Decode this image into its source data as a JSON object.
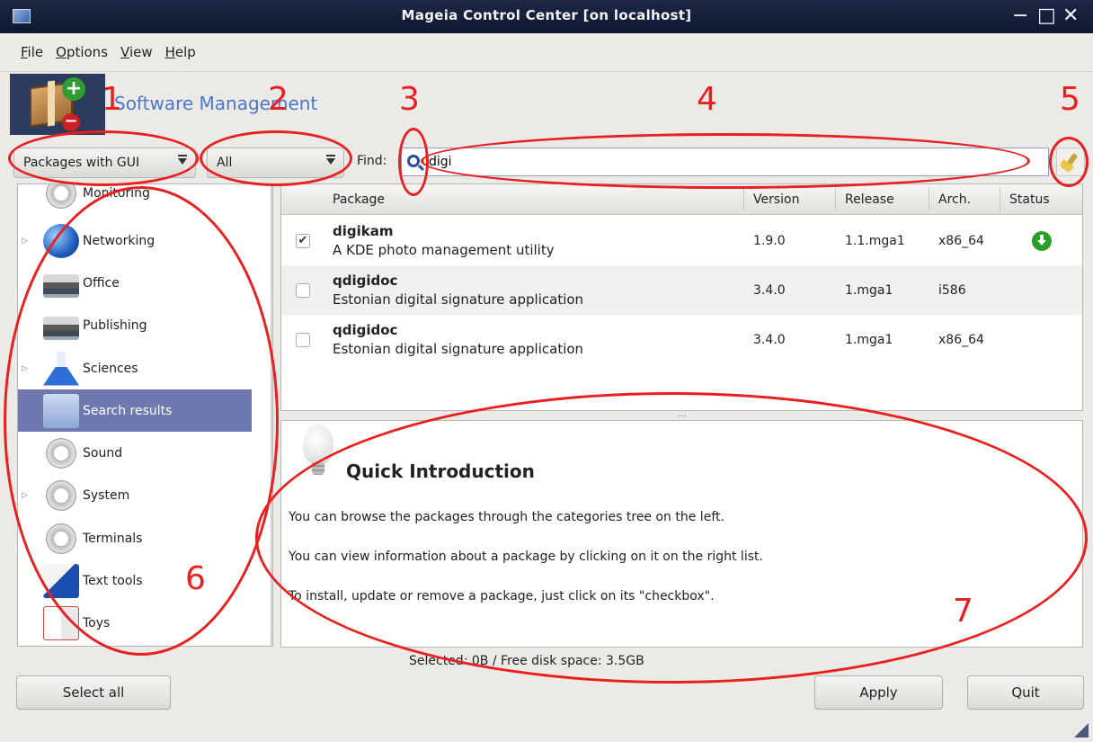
{
  "window": {
    "title": "Mageia Control Center  [on localhost]",
    "controls": {
      "minimize": "−",
      "maximize": "□",
      "close": "✕"
    }
  },
  "menu": [
    {
      "label": "File",
      "mnemonic": "F",
      "rest": "ile"
    },
    {
      "label": "Options",
      "mnemonic": "O",
      "rest": "ptions"
    },
    {
      "label": "View",
      "mnemonic": "V",
      "rest": "iew"
    },
    {
      "label": "Help",
      "mnemonic": "H",
      "rest": "elp"
    }
  ],
  "header": {
    "title": "Software Management"
  },
  "annotations": [
    "1",
    "2",
    "3",
    "4",
    "5",
    "6",
    "7"
  ],
  "filters": {
    "type_filter": "Packages with GUI",
    "state_filter": "All",
    "find_label": "Find:",
    "search_value": "digi"
  },
  "categories": [
    {
      "label": "Monitoring",
      "icon": "gear-icon",
      "expandable": false,
      "selected": false
    },
    {
      "label": "Networking",
      "icon": "globe-icon",
      "expandable": true,
      "selected": false
    },
    {
      "label": "Office",
      "icon": "printer-icon",
      "expandable": false,
      "selected": false
    },
    {
      "label": "Publishing",
      "icon": "printer-icon",
      "expandable": false,
      "selected": false
    },
    {
      "label": "Sciences",
      "icon": "flask-icon",
      "expandable": true,
      "selected": false
    },
    {
      "label": "Search results",
      "icon": "search-results-icon",
      "expandable": false,
      "selected": true
    },
    {
      "label": "Sound",
      "icon": "gear-icon",
      "expandable": false,
      "selected": false
    },
    {
      "label": "System",
      "icon": "gear-icon",
      "expandable": true,
      "selected": false
    },
    {
      "label": "Terminals",
      "icon": "gear-icon",
      "expandable": false,
      "selected": false
    },
    {
      "label": "Text tools",
      "icon": "text-tools-icon",
      "expandable": false,
      "selected": false
    },
    {
      "label": "Toys",
      "icon": "toys-icon",
      "expandable": false,
      "selected": false
    }
  ],
  "package_table": {
    "columns": [
      "Package",
      "Version",
      "Release",
      "Arch.",
      "Status"
    ],
    "rows": [
      {
        "name": "digikam",
        "summary": "A KDE photo management utility",
        "version": "1.9.0",
        "release": "1.1.mga1",
        "arch": "x86_64",
        "checked": true,
        "status_icon": "install-icon"
      },
      {
        "name": "qdigidoc",
        "summary": "Estonian digital signature application",
        "version": "3.4.0",
        "release": "1.mga1",
        "arch": "i586",
        "checked": false,
        "status_icon": ""
      },
      {
        "name": "qdigidoc",
        "summary": "Estonian digital signature application",
        "version": "3.4.0",
        "release": "1.mga1",
        "arch": "x86_64",
        "checked": false,
        "status_icon": ""
      }
    ]
  },
  "splitter_label": "...",
  "intro": {
    "title": "Quick Introduction",
    "lines": [
      "You can browse the packages through the categories tree on the left.",
      "You can view information about a package by clicking on it on the right list.",
      "To install, update or remove a package, just click on its \"checkbox\"."
    ]
  },
  "status": {
    "text": "Selected: 0B / Free disk space: 3.5GB"
  },
  "buttons": {
    "select_all": "Select all",
    "apply": "Apply",
    "quit": "Quit"
  },
  "colors": {
    "annotation": "#e82020",
    "title_blue": "#4a78c8",
    "selection": "#6f79b0",
    "titlebar": "#1c2845"
  }
}
